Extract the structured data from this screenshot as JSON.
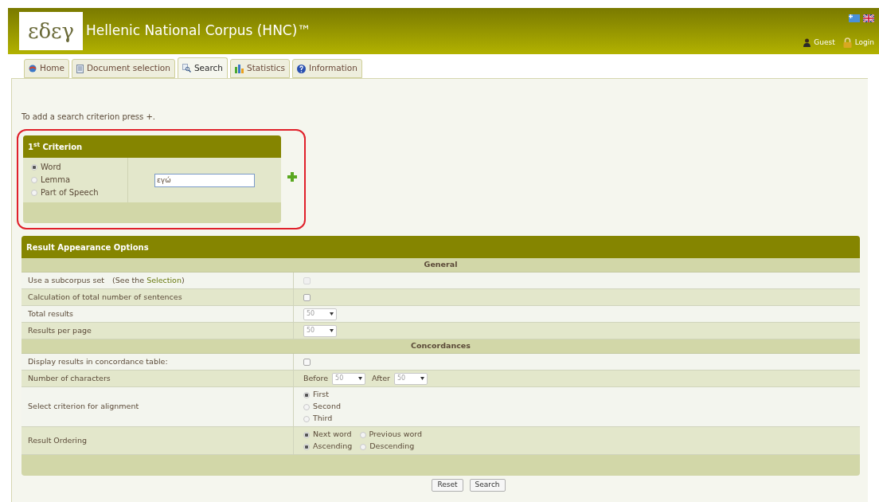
{
  "header": {
    "logo": "εδεγ",
    "title": "Hellenic National Corpus (HNC)™",
    "languages": [
      {
        "kind": "greek"
      },
      {
        "kind": "english"
      }
    ],
    "user": "Guest",
    "login": "Login"
  },
  "tabs": [
    {
      "label": "Home",
      "selected": false
    },
    {
      "label": "Document selection",
      "selected": false
    },
    {
      "label": "Search",
      "selected": true
    },
    {
      "label": "Statistics",
      "selected": false
    },
    {
      "label": "Information",
      "selected": false
    }
  ],
  "hint": "To add a search criterion press +.",
  "criterion": {
    "title": "1$^{st}$ Criterion",
    "options": [
      {
        "label": "Word",
        "selected": true
      },
      {
        "label": "Lemma",
        "selected": false
      },
      {
        "label": "Part of Speech",
        "selected": false
      }
    ],
    "value": "εγώ"
  },
  "options": {
    "title": "Result Appearance Options",
    "sections": [
      {
        "title": "General",
        "rows": [
          {
            "label": "Use a subcorpus set",
            "note_before": "(See the ",
            "link": "Selection",
            "note_after": ")",
            "kind": "checkbox",
            "checked": false,
            "disabled": true
          },
          {
            "label": "Calculation of total number of sentences",
            "kind": "checkbox",
            "checked": false,
            "disabled": false
          },
          {
            "label": "Total results",
            "kind": "select",
            "value": "50"
          },
          {
            "label": "Results per page",
            "kind": "select",
            "value": "50"
          }
        ]
      },
      {
        "title": "Concordances",
        "rows": [
          {
            "label": "Display results in concordance table:",
            "kind": "checkbox",
            "checked": false,
            "disabled": false
          },
          {
            "label": "Number of characters",
            "kind": "pair",
            "before_label": "Before",
            "before_value": "50",
            "after_label": "After",
            "after_value": "50"
          },
          {
            "label": "Select criterion for alignment",
            "kind": "radios",
            "lines": [
              [
                {
                  "label": "First",
                  "selected": true
                }
              ],
              [
                {
                  "label": "Second",
                  "selected": false
                }
              ],
              [
                {
                  "label": "Third",
                  "selected": false
                }
              ]
            ]
          },
          {
            "label": "Result Ordering",
            "kind": "radios",
            "lines": [
              [
                {
                  "label": "Next word",
                  "selected": true
                },
                {
                  "label": "Previous word",
                  "selected": false
                }
              ],
              [
                {
                  "label": "Ascending",
                  "selected": true
                },
                {
                  "label": "Descending",
                  "selected": false
                }
              ]
            ]
          }
        ]
      }
    ]
  },
  "buttons": [
    "Reset",
    "Search"
  ]
}
